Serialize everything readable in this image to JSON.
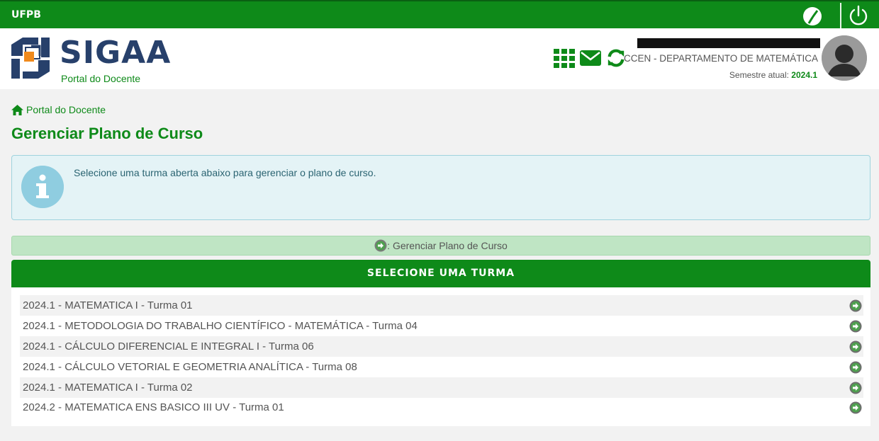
{
  "topbar": {
    "brand": "UFPB"
  },
  "header": {
    "logo_text": "SIGAA",
    "logo_sub": "Portal do Docente",
    "department": "CCEN - DEPARTAMENTO DE MATEMÁTICA",
    "semester_label": "Semestre atual:",
    "semester_value": "2024.1"
  },
  "breadcrumb": {
    "label": "Portal do Docente"
  },
  "page": {
    "title": "Gerenciar Plano de Curso"
  },
  "info": {
    "message": "Selecione uma turma aberta abaixo para gerenciar o plano de curso."
  },
  "legend": {
    "label": ": Gerenciar Plano de Curso"
  },
  "table": {
    "header": "SELECIONE UMA TURMA",
    "rows": [
      "2024.1 - MATEMATICA I - Turma 01",
      "2024.1 - METODOLOGIA DO TRABALHO CIENTÍFICO - MATEMÁTICA - Turma 04",
      "2024.1 - CÁLCULO DIFERENCIAL E INTEGRAL I - Turma 06",
      "2024.1 - CÁLCULO VETORIAL E GEOMETRIA ANALÍTICA - Turma 08",
      "2024.1 - MATEMATICA I - Turma 02",
      "2024.2 - MATEMATICA ENS BASICO III UV - Turma 01"
    ]
  },
  "colors": {
    "brand_green": "#0e8a19",
    "logo_blue": "#27406b",
    "info_bg": "#e4f3f6",
    "legend_bg": "#bfe5c4"
  },
  "icons": [
    "contrast-icon",
    "power-icon",
    "apps-grid-icon",
    "mail-icon",
    "refresh-icon",
    "user-avatar-icon",
    "home-icon",
    "info-icon",
    "arrow-right-circle-icon"
  ]
}
